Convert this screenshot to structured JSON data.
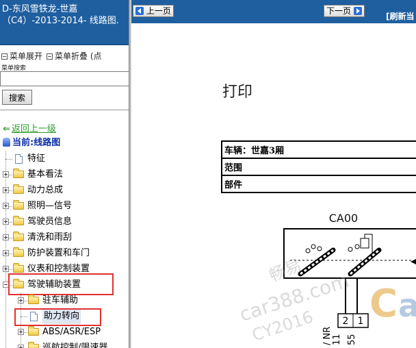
{
  "left": {
    "title": "D-东风雪铁龙-世嘉（C4）-2013-2014- 线路图.",
    "menu_expand": "菜单展开",
    "menu_collapse": "菜单折叠 (点",
    "search_label": "菜单搜索",
    "search_value": "",
    "search_button": "搜索",
    "back_link": "返回上一级",
    "current_label": "当前:线路图"
  },
  "tree": [
    {
      "label": "特征",
      "type": "doc",
      "level": 0
    },
    {
      "label": "基本看法",
      "type": "folder",
      "level": 0
    },
    {
      "label": "动力总成",
      "type": "folder",
      "level": 0
    },
    {
      "label": "照明—信号",
      "type": "folder",
      "level": 0
    },
    {
      "label": "驾驶员信息",
      "type": "folder",
      "level": 0
    },
    {
      "label": "清洗和雨刮",
      "type": "folder",
      "level": 0
    },
    {
      "label": "防护装置和车门",
      "type": "folder",
      "level": 0
    },
    {
      "label": "仪表和控制装置",
      "type": "folder",
      "level": 0
    },
    {
      "label": "驾驶辅助装置",
      "type": "folder-open",
      "level": 0,
      "highlighted": true
    },
    {
      "label": "驻车辅助",
      "type": "folder",
      "level": 1
    },
    {
      "label": "助力转向",
      "type": "doc",
      "level": 1,
      "highlighted": true,
      "selected": true
    },
    {
      "label": "ABS/ASR/ESP",
      "type": "folder",
      "level": 1
    },
    {
      "label": "巡航控制/限速器",
      "type": "folder",
      "level": 1
    }
  ],
  "toolbar": {
    "prev": "上一页",
    "next": "下一页",
    "refresh": "[刷新当"
  },
  "document": {
    "title": "打印",
    "rows": [
      {
        "label": "车辆：世嘉3厢"
      },
      {
        "label": "范围"
      },
      {
        "label": "部件"
      }
    ],
    "component": "CA00",
    "pins": [
      "2",
      "1"
    ],
    "wire_labels": [
      "11",
      "55",
      "/ NR"
    ],
    "watermarks": [
      "畅易",
      "car388.com",
      "CY2016"
    ]
  },
  "colors": {
    "header_blue": "#1f5fa0",
    "highlight_red": "#e2312f",
    "link_green": "#2a9a2a",
    "current_blue": "#0b2fa8"
  }
}
